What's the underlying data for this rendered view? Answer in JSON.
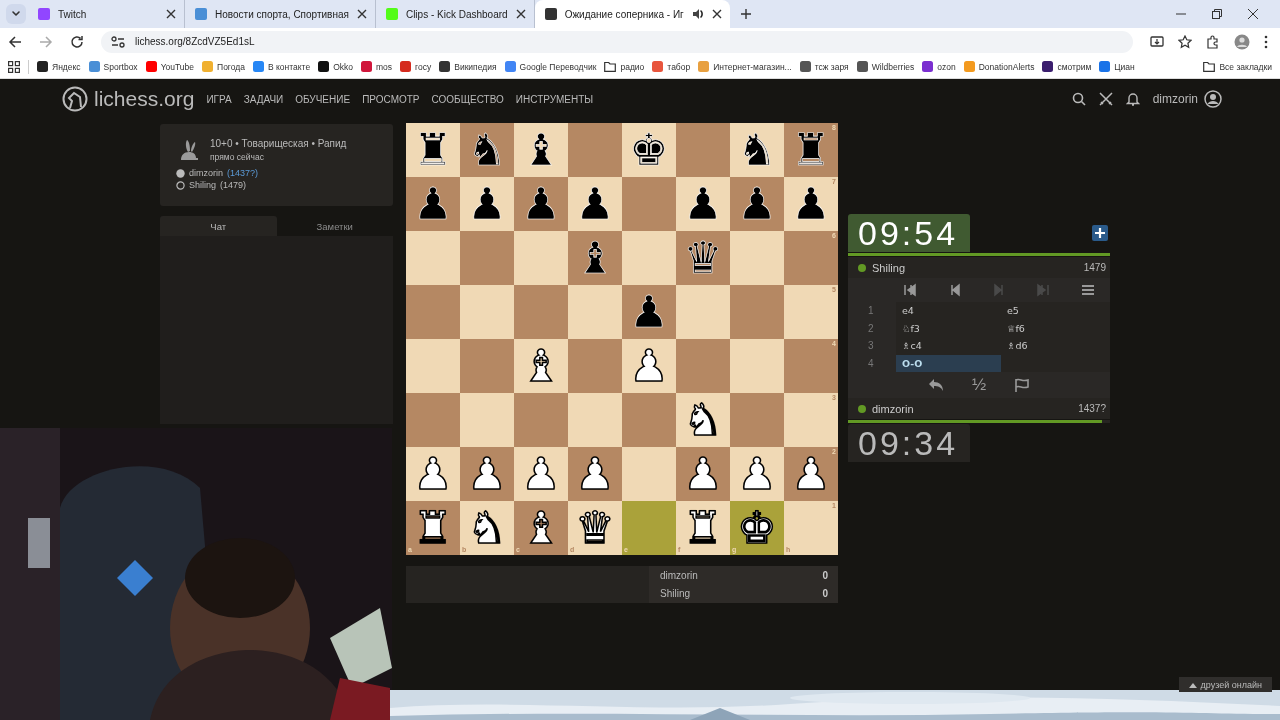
{
  "browser": {
    "tabs": [
      {
        "title": "Twitch",
        "color": "#9146ff",
        "selected": false,
        "audio": false
      },
      {
        "title": "Новости спорта, Спортивная",
        "color": "#4a8fd6",
        "selected": false,
        "audio": false
      },
      {
        "title": "Clips - Kick Dashboard",
        "color": "#53fc18",
        "selected": false,
        "audio": false
      },
      {
        "title": "Ожидание соперника - Иг",
        "color": "#333333",
        "selected": true,
        "audio": true
      }
    ],
    "address": {
      "url": "lichess.org/8ZcdVZ5Ed1sL",
      "forward_disabled": true
    },
    "bookmarks": [
      {
        "label": "Яндекс",
        "kind": "site",
        "color": "#222222"
      },
      {
        "label": "Sportbox",
        "kind": "site",
        "color": "#4a8fd6"
      },
      {
        "label": "YouTube",
        "kind": "site",
        "color": "#ff0000"
      },
      {
        "label": "Погода",
        "kind": "site",
        "color": "#f0b030"
      },
      {
        "label": "В контакте",
        "kind": "site",
        "color": "#2787f5"
      },
      {
        "label": "Okko",
        "kind": "site",
        "color": "#111111"
      },
      {
        "label": "mos",
        "kind": "site",
        "color": "#d0163b"
      },
      {
        "label": "госу",
        "kind": "site",
        "color": "#d52b1e"
      },
      {
        "label": "Википедия",
        "kind": "site",
        "color": "#333333"
      },
      {
        "label": "Google Переводчик",
        "kind": "site",
        "color": "#4285f4"
      },
      {
        "label": "радио",
        "kind": "folder"
      },
      {
        "label": "табор",
        "kind": "site",
        "color": "#e8553d"
      },
      {
        "label": "Интернет-магазин...",
        "kind": "site",
        "color": "#e8a040"
      },
      {
        "label": "тсж заря",
        "kind": "site",
        "color": "#555555"
      },
      {
        "label": "Wildberries",
        "kind": "site",
        "color": "#555555"
      },
      {
        "label": "ozon",
        "kind": "site",
        "color": "#7b2fd0"
      },
      {
        "label": "DonationAlerts",
        "kind": "site",
        "color": "#f39a1f"
      },
      {
        "label": "смотрим",
        "kind": "site",
        "color": "#3b1e6e"
      },
      {
        "label": "Циан",
        "kind": "site",
        "color": "#1a73e8"
      }
    ],
    "all_bookmarks": "Все закладки"
  },
  "site": {
    "logo": "lichess.org",
    "nav": [
      "ИГРА",
      "ЗАДАЧИ",
      "ОБУЧЕНИЕ",
      "ПРОСМОТР",
      "СООБЩЕСТВО",
      "ИНСТРУМЕНТЫ"
    ],
    "user": "dimzorin"
  },
  "game_info": {
    "title": "10+0 • Товарищеская • Рапид",
    "time": "прямо сейчас",
    "players": [
      {
        "name": "dimzorin",
        "rating": "(1437?)",
        "white": true,
        "provisional": true
      },
      {
        "name": "Shiling",
        "rating": "(1479)",
        "white": false,
        "provisional": false
      }
    ]
  },
  "chat_tabs": [
    {
      "label": "Чат",
      "selected": true
    },
    {
      "label": "Заметки",
      "selected": false
    }
  ],
  "board": {
    "ranks": [
      [
        {
          "kind": "piece",
          "piece": "♜",
          "white": false,
          "highlighted": false
        },
        {
          "kind": "piece",
          "piece": "♞",
          "white": false,
          "highlighted": false
        },
        {
          "kind": "piece",
          "piece": "♝",
          "white": false,
          "highlighted": false
        },
        {
          "kind": "empty",
          "highlighted": false
        },
        {
          "kind": "piece",
          "piece": "♚",
          "white": false,
          "highlighted": false
        },
        {
          "kind": "empty",
          "highlighted": false
        },
        {
          "kind": "piece",
          "piece": "♞",
          "white": false,
          "highlighted": false
        },
        {
          "kind": "piece",
          "piece": "♜",
          "white": false,
          "highlighted": false
        }
      ],
      [
        {
          "kind": "piece",
          "piece": "♟",
          "white": false,
          "highlighted": false
        },
        {
          "kind": "piece",
          "piece": "♟",
          "white": false,
          "highlighted": false
        },
        {
          "kind": "piece",
          "piece": "♟",
          "white": false,
          "highlighted": false
        },
        {
          "kind": "piece",
          "piece": "♟",
          "white": false,
          "highlighted": false
        },
        {
          "kind": "empty",
          "highlighted": false
        },
        {
          "kind": "piece",
          "piece": "♟",
          "white": false,
          "highlighted": false
        },
        {
          "kind": "piece",
          "piece": "♟",
          "white": false,
          "highlighted": false
        },
        {
          "kind": "piece",
          "piece": "♟",
          "white": false,
          "highlighted": false
        }
      ],
      [
        {
          "kind": "empty",
          "highlighted": false
        },
        {
          "kind": "empty",
          "highlighted": false
        },
        {
          "kind": "empty",
          "highlighted": false
        },
        {
          "kind": "piece",
          "piece": "♝",
          "white": false,
          "highlighted": false
        },
        {
          "kind": "empty",
          "highlighted": false
        },
        {
          "kind": "piece",
          "piece": "♛",
          "white": false,
          "highlighted": false
        },
        {
          "kind": "empty",
          "highlighted": false
        },
        {
          "kind": "empty",
          "highlighted": false
        }
      ],
      [
        {
          "kind": "empty",
          "highlighted": false
        },
        {
          "kind": "empty",
          "highlighted": false
        },
        {
          "kind": "empty",
          "highlighted": false
        },
        {
          "kind": "empty",
          "highlighted": false
        },
        {
          "kind": "piece",
          "piece": "♟",
          "white": false,
          "highlighted": false
        },
        {
          "kind": "empty",
          "highlighted": false
        },
        {
          "kind": "empty",
          "highlighted": false
        },
        {
          "kind": "empty",
          "highlighted": false
        }
      ],
      [
        {
          "kind": "empty",
          "highlighted": false
        },
        {
          "kind": "empty",
          "highlighted": false
        },
        {
          "kind": "piece",
          "piece": "♝",
          "white": true,
          "highlighted": false
        },
        {
          "kind": "empty",
          "highlighted": false
        },
        {
          "kind": "piece",
          "piece": "♟",
          "white": true,
          "highlighted": false
        },
        {
          "kind": "empty",
          "highlighted": false
        },
        {
          "kind": "empty",
          "highlighted": false
        },
        {
          "kind": "empty",
          "highlighted": false
        }
      ],
      [
        {
          "kind": "empty",
          "highlighted": false
        },
        {
          "kind": "empty",
          "highlighted": false
        },
        {
          "kind": "empty",
          "highlighted": false
        },
        {
          "kind": "empty",
          "highlighted": false
        },
        {
          "kind": "empty",
          "highlighted": false
        },
        {
          "kind": "piece",
          "piece": "♞",
          "white": true,
          "highlighted": false
        },
        {
          "kind": "empty",
          "highlighted": false
        },
        {
          "kind": "empty",
          "highlighted": false
        }
      ],
      [
        {
          "kind": "piece",
          "piece": "♟",
          "white": true,
          "highlighted": false
        },
        {
          "kind": "piece",
          "piece": "♟",
          "white": true,
          "highlighted": false
        },
        {
          "kind": "piece",
          "piece": "♟",
          "white": true,
          "highlighted": false
        },
        {
          "kind": "piece",
          "piece": "♟",
          "white": true,
          "highlighted": false
        },
        {
          "kind": "empty",
          "highlighted": false
        },
        {
          "kind": "piece",
          "piece": "♟",
          "white": true,
          "highlighted": false
        },
        {
          "kind": "piece",
          "piece": "♟",
          "white": true,
          "highlighted": false
        },
        {
          "kind": "piece",
          "piece": "♟",
          "white": true,
          "highlighted": false
        }
      ],
      [
        {
          "kind": "piece",
          "piece": "♜",
          "white": true,
          "highlighted": false
        },
        {
          "kind": "piece",
          "piece": "♞",
          "white": true,
          "highlighted": false
        },
        {
          "kind": "piece",
          "piece": "♝",
          "white": true,
          "highlighted": false
        },
        {
          "kind": "piece",
          "piece": "♛",
          "white": true,
          "highlighted": false
        },
        {
          "kind": "empty",
          "highlighted": true
        },
        {
          "kind": "piece",
          "piece": "♜",
          "white": true,
          "highlighted": false
        },
        {
          "kind": "piece",
          "piece": "♚",
          "white": true,
          "highlighted": true
        },
        {
          "kind": "empty",
          "highlighted": false
        }
      ]
    ],
    "rank_labels": [
      "8",
      "7",
      "6",
      "5",
      "4",
      "3",
      "2",
      "1"
    ],
    "file_labels": [
      "a",
      "b",
      "c",
      "d",
      "e",
      "f",
      "g",
      "h"
    ]
  },
  "crosstable": [
    {
      "name": "dimzorin",
      "score": "0"
    },
    {
      "name": "Shiling",
      "score": "0"
    }
  ],
  "opponent": {
    "time": "09:54",
    "running": true,
    "level": 1,
    "name": "Shiling",
    "rating": "1479",
    "online": true
  },
  "player": {
    "time": "09:34",
    "running": false,
    "level": 0.97,
    "name": "dimzorin",
    "rating": "1437?",
    "online": true
  },
  "move_controls": [
    {
      "kind": "first",
      "disabled": false
    },
    {
      "kind": "prev",
      "disabled": false
    },
    {
      "kind": "next",
      "disabled": true
    },
    {
      "kind": "last",
      "disabled": true
    },
    {
      "kind": "menu",
      "disabled": false
    }
  ],
  "moves": [
    {
      "number": "1",
      "plies": [
        {
          "san": "e4",
          "selected": false
        },
        {
          "san": "e5",
          "selected": false
        }
      ]
    },
    {
      "number": "2",
      "plies": [
        {
          "san": "♘f3",
          "selected": false
        },
        {
          "san": "♕f6",
          "selected": false
        }
      ]
    },
    {
      "number": "3",
      "plies": [
        {
          "san": "♗c4",
          "selected": false
        },
        {
          "san": "♗d6",
          "selected": false
        }
      ]
    },
    {
      "number": "4",
      "plies": [
        {
          "san": "O-O",
          "selected": true
        }
      ]
    }
  ],
  "game_actions": [
    {
      "kind": "takeback"
    },
    {
      "kind": "draw",
      "label": "½"
    },
    {
      "kind": "resign"
    }
  ],
  "friends_button": "друзей онлайн"
}
